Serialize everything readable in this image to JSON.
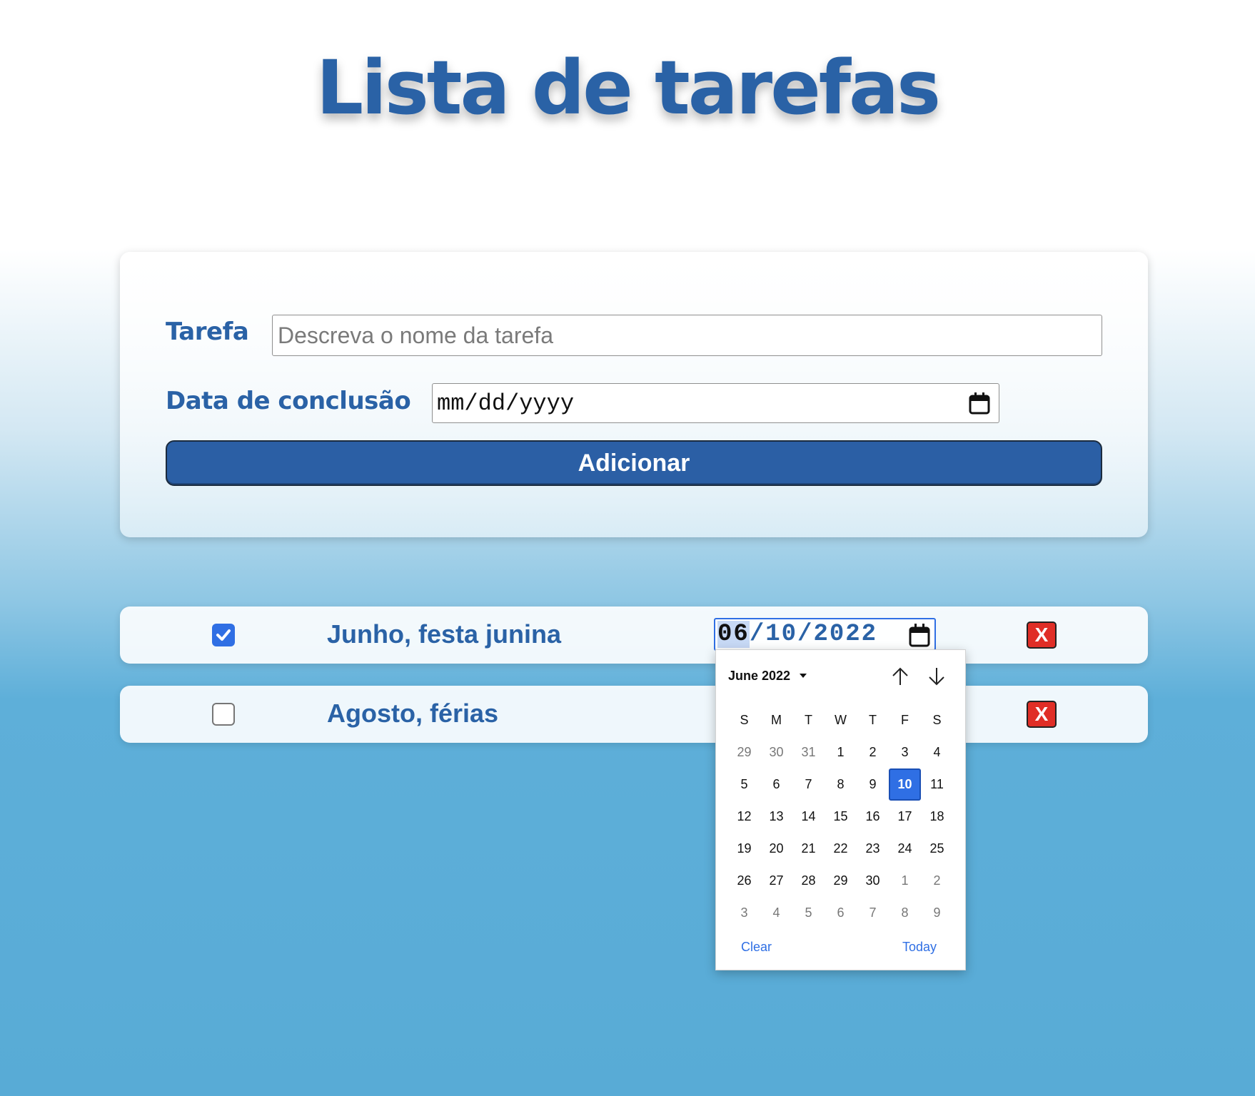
{
  "title": "Lista de tarefas",
  "form": {
    "task_label": "Tarefa",
    "task_placeholder": "Descreva o nome da tarefa",
    "date_label": "Data de conclusão",
    "date_placeholder": "mm/dd/yyyy",
    "add_button": "Adicionar"
  },
  "tasks": [
    {
      "name": "Junho, festa junina",
      "done": true,
      "date": {
        "month": "06",
        "day": "10",
        "year": "2022"
      },
      "delete_label": "X"
    },
    {
      "name": "Agosto, férias",
      "done": false,
      "delete_label": "X"
    }
  ],
  "date_picker": {
    "month_label": "June 2022",
    "weekdays": [
      "S",
      "M",
      "T",
      "W",
      "T",
      "F",
      "S"
    ],
    "weeks": [
      [
        "29",
        "30",
        "31",
        "1",
        "2",
        "3",
        "4"
      ],
      [
        "5",
        "6",
        "7",
        "8",
        "9",
        "10",
        "11"
      ],
      [
        "12",
        "13",
        "14",
        "15",
        "16",
        "17",
        "18"
      ],
      [
        "19",
        "20",
        "21",
        "22",
        "23",
        "24",
        "25"
      ],
      [
        "26",
        "27",
        "28",
        "29",
        "30",
        "1",
        "2"
      ],
      [
        "3",
        "4",
        "5",
        "6",
        "7",
        "8",
        "9"
      ]
    ],
    "selected_day": "10",
    "clear_label": "Clear",
    "today_label": "Today"
  },
  "colors": {
    "accent": "#2a62a6",
    "button": "#2b5fa5",
    "delete": "#e02e26",
    "checkbox": "#2f6fe4"
  },
  "icons": [
    "calendar-icon",
    "check-icon",
    "arrow-up-icon",
    "arrow-down-icon",
    "caret-down-icon"
  ]
}
